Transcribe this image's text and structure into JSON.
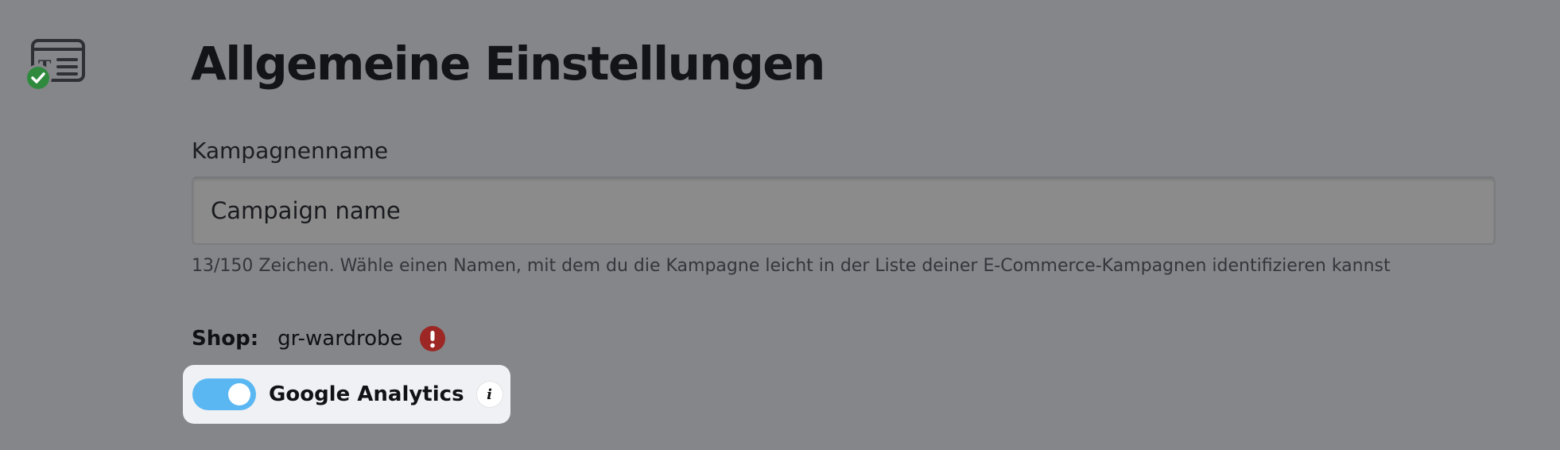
{
  "step": {
    "icon": "text-card-icon",
    "status_icon": "check-circle-icon",
    "status_color": "#2f8a3e"
  },
  "page": {
    "title": "Allgemeine Einstellungen"
  },
  "campaign_name": {
    "label": "Kampagnenname",
    "value": "Campaign name",
    "hint": "13/150 Zeichen. Wähle einen Namen, mit dem du die Kampagne leicht in der Liste deiner E-Commerce-Kampagnen identifizieren kannst"
  },
  "shop": {
    "label": "Shop:",
    "value": "gr-wardrobe",
    "warning_icon": "exclamation-circle-icon",
    "warning_color": "#9c2724"
  },
  "google_analytics": {
    "label": "Google Analytics",
    "enabled": true,
    "toggle_color": "#5ab7f2",
    "info_icon": "info-icon",
    "info_glyph": "i"
  }
}
